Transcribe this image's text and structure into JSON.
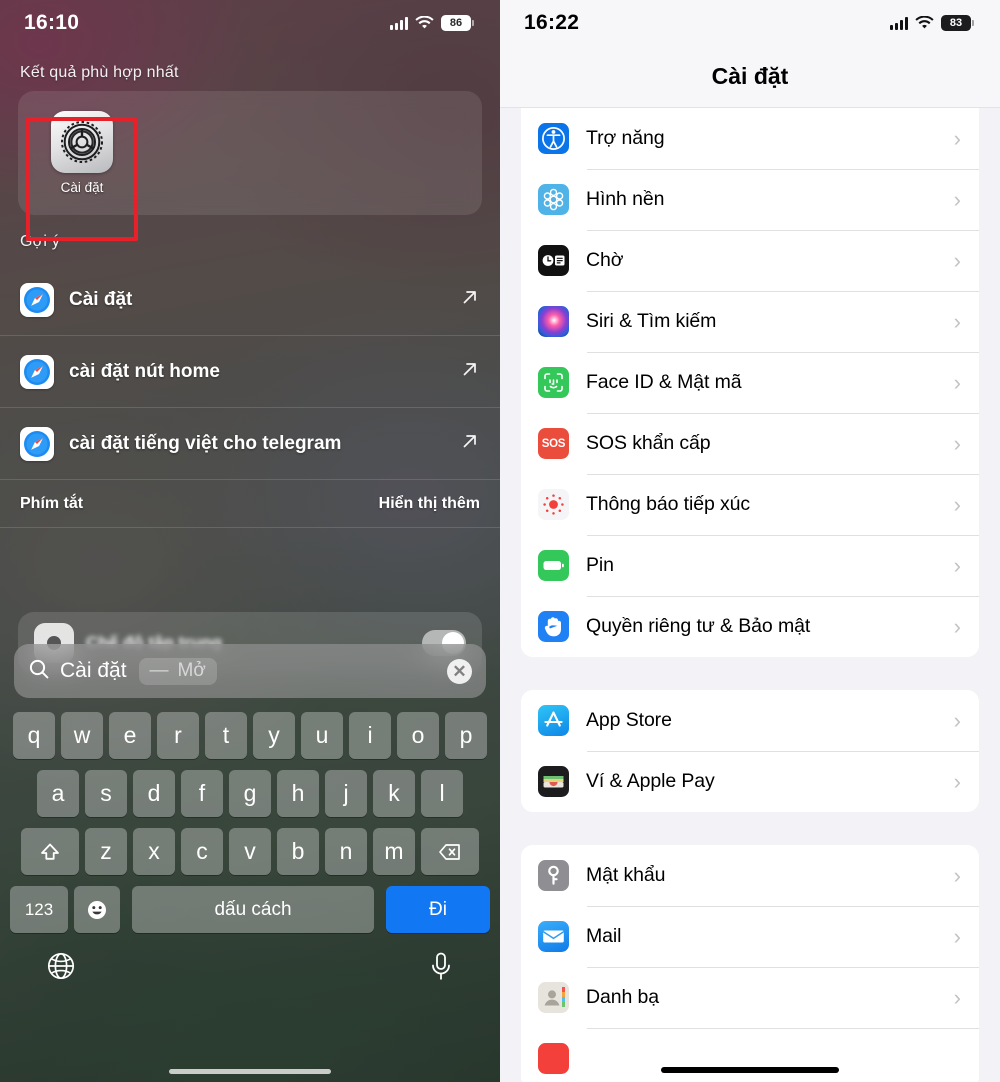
{
  "left_panel": {
    "status_bar": {
      "time": "16:10",
      "battery": "86",
      "cellular_icon": "cellular-bars-icon",
      "wifi_icon": "wifi-icon",
      "battery_icon": "battery-icon"
    },
    "top_hit_header": "Kết quả phù hợp nhất",
    "top_hit": {
      "app_name": "Cài đặt",
      "icon": "settings-gear-icon"
    },
    "suggestions_header": "Gợi ý",
    "suggestions": [
      {
        "label": "Cài đặt",
        "icon": "safari-icon",
        "action_icon": "arrow-up-right-icon"
      },
      {
        "label": "cài đặt nút home",
        "icon": "safari-icon",
        "action_icon": "arrow-up-right-icon"
      },
      {
        "label": "cài đặt tiếng việt cho telegram",
        "icon": "safari-icon",
        "action_icon": "arrow-up-right-icon"
      }
    ],
    "shortcuts_row": {
      "left_label": "Phím tắt",
      "right_label": "Hiển thị thêm"
    },
    "search": {
      "icon": "search-icon",
      "value": "Cài đặt",
      "chip_dash": "—",
      "chip_action": "Mở",
      "clear_icon": "clear-circle-icon",
      "clear_glyph": "✕"
    },
    "keyboard": {
      "row1": [
        "q",
        "w",
        "e",
        "r",
        "t",
        "y",
        "u",
        "i",
        "o",
        "p"
      ],
      "row2": [
        "a",
        "s",
        "d",
        "f",
        "g",
        "h",
        "j",
        "k",
        "l"
      ],
      "row3": [
        "z",
        "x",
        "c",
        "v",
        "b",
        "n",
        "m"
      ],
      "shift_icon": "shift-icon",
      "backspace_icon": "backspace-icon",
      "numeric_key": "123",
      "emoji_key": "emoji-icon",
      "space_key": "dấu cách",
      "go_key": "Đi",
      "go_key_color": "#1277f2",
      "globe_icon": "globe-icon",
      "mic_icon": "microphone-icon"
    }
  },
  "right_panel": {
    "status_bar": {
      "time": "16:22",
      "battery": "83",
      "cellular_icon": "cellular-bars-icon",
      "wifi_icon": "wifi-icon",
      "battery_icon": "battery-icon"
    },
    "title": "Cài đặt",
    "groups": [
      {
        "rows": [
          {
            "label": "Trợ năng",
            "icon": "accessibility-icon",
            "icon_color": "#0a74e8",
            "chevron": "›"
          },
          {
            "label": "Hình nền",
            "icon": "wallpaper-icon",
            "icon_color": "#4fb3e8",
            "chevron": "›"
          },
          {
            "label": "Chờ",
            "icon": "standby-icon",
            "icon_color": "#111111",
            "chevron": "›"
          },
          {
            "label": "Siri & Tìm kiếm",
            "icon": "siri-icon",
            "icon_color": "#2b1a3a",
            "chevron": "›"
          },
          {
            "label": "Face ID & Mật mã",
            "icon": "face-id-icon",
            "icon_color": "#34c759",
            "chevron": "›"
          },
          {
            "label": "SOS khẩn cấp",
            "icon": "sos-icon",
            "icon_color": "#eb4d3d",
            "chevron": "›"
          },
          {
            "label": "Thông báo tiếp xúc",
            "icon": "exposure-notification-icon",
            "icon_color": "#f5f5f7",
            "chevron": "›"
          },
          {
            "label": "Pin",
            "icon": "battery-icon",
            "icon_color": "#34c759",
            "chevron": "›"
          },
          {
            "label": "Quyền riêng tư & Bảo mật",
            "icon": "privacy-hand-icon",
            "icon_color": "#2081f4",
            "chevron": "›",
            "highlighted": true
          }
        ]
      },
      {
        "rows": [
          {
            "label": "App Store",
            "icon": "app-store-icon",
            "icon_color": "#1e9bf0",
            "chevron": "›"
          },
          {
            "label": "Ví & Apple Pay",
            "icon": "wallet-icon",
            "icon_color": "#1c1c1e",
            "chevron": "›"
          }
        ]
      },
      {
        "rows": [
          {
            "label": "Mật khẩu",
            "icon": "key-icon",
            "icon_color": "#8e8e93",
            "chevron": "›"
          },
          {
            "label": "Mail",
            "icon": "mail-icon",
            "icon_color": "#1d9bf5",
            "chevron": "›"
          },
          {
            "label": "Danh bạ",
            "icon": "contacts-icon",
            "icon_color": "#c9c6bf",
            "chevron": "›"
          }
        ]
      }
    ],
    "highlight_color": "#e8202a"
  }
}
